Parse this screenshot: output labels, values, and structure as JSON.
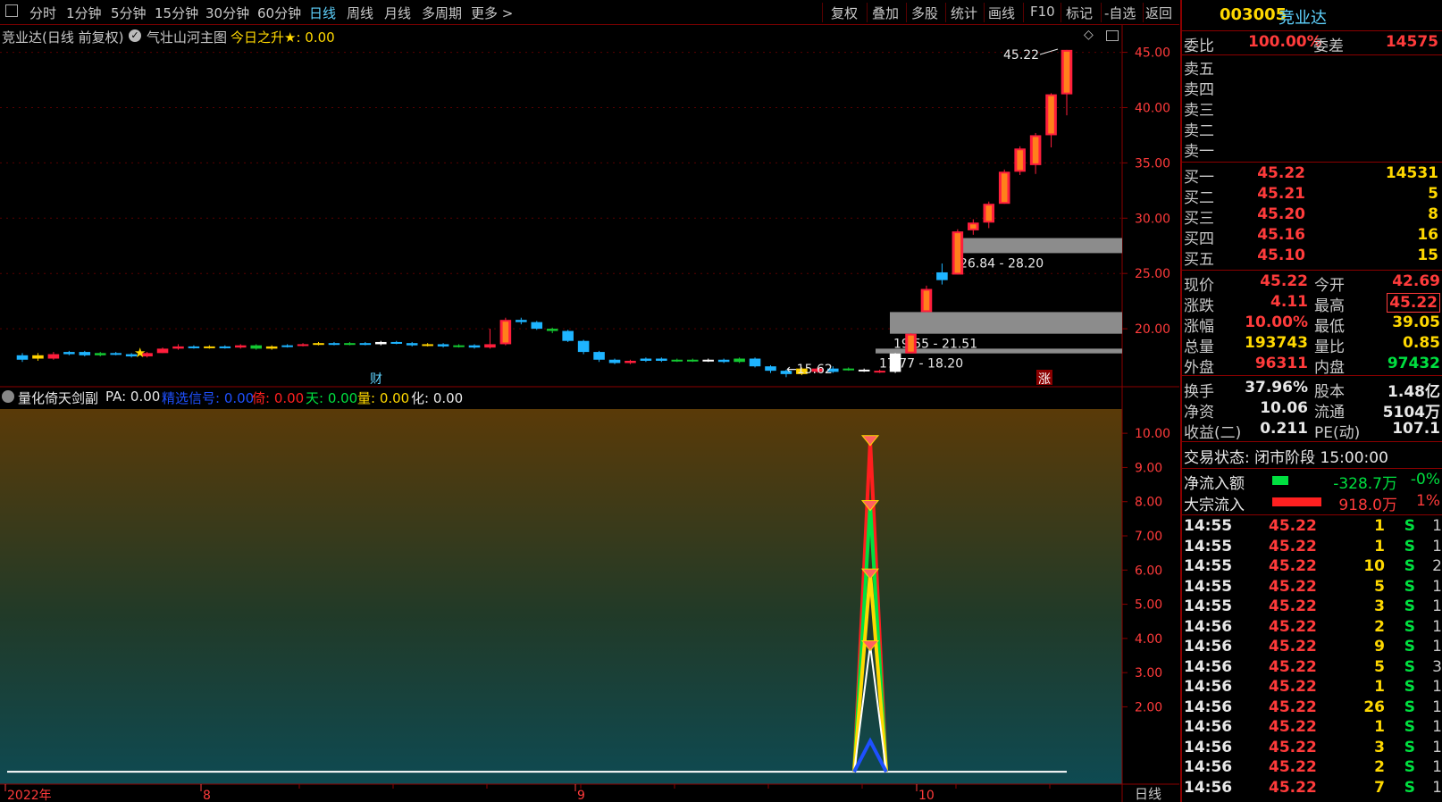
{
  "toolbar": {
    "left_items": [
      "分时",
      "1分钟",
      "5分钟",
      "15分钟",
      "30分钟",
      "60分钟",
      "日线",
      "周线",
      "月线",
      "多周期",
      "更多 >"
    ],
    "active": "日线",
    "right_items": [
      "复权",
      "叠加",
      "多股",
      "统计",
      "画线",
      "F10",
      "标记",
      "-自选",
      "返回"
    ]
  },
  "chart": {
    "title": "竞业达(日线 前复权)",
    "indicator": "气壮山河主图",
    "today_label": "今日之升★: 0.00",
    "price_axis": [
      "45.00",
      "40.00",
      "35.00",
      "30.00",
      "25.00",
      "20.00"
    ],
    "price_range": [
      15,
      46.5
    ],
    "high_label": "45.22",
    "low_label": "←15.62",
    "zones": [
      {
        "label": "26.84 - 28.20",
        "lo": 26.84,
        "hi": 28.2
      },
      {
        "label": "19.55 - 21.51",
        "lo": 19.55,
        "hi": 21.51
      },
      {
        "label": "17.77 - 18.20",
        "lo": 17.77,
        "hi": 18.2
      }
    ],
    "marker_cai": "财",
    "marker_zhang": "涨",
    "candles": [
      [
        17.2,
        17.6,
        17.0,
        17.8,
        "c"
      ],
      [
        17.6,
        17.3,
        17.1,
        17.8,
        "y"
      ],
      [
        17.3,
        17.7,
        17.2,
        17.9,
        "r"
      ],
      [
        17.7,
        17.9,
        17.6,
        18.0,
        "c"
      ],
      [
        17.9,
        17.6,
        17.5,
        18.0,
        "c"
      ],
      [
        17.6,
        17.8,
        17.5,
        17.9,
        "g"
      ],
      [
        17.8,
        17.7,
        17.6,
        17.9,
        "c"
      ],
      [
        17.7,
        17.5,
        17.4,
        17.8,
        "c"
      ],
      [
        17.5,
        17.8,
        17.4,
        17.9,
        "r"
      ],
      [
        17.8,
        18.2,
        17.8,
        18.3,
        "r"
      ],
      [
        18.2,
        18.4,
        18.1,
        18.6,
        "r"
      ],
      [
        18.4,
        18.3,
        18.2,
        18.5,
        "c"
      ],
      [
        18.3,
        18.4,
        18.2,
        18.5,
        "y"
      ],
      [
        18.4,
        18.3,
        18.2,
        18.5,
        "c"
      ],
      [
        18.3,
        18.5,
        18.2,
        18.6,
        "r"
      ],
      [
        18.5,
        18.2,
        18.1,
        18.6,
        "g"
      ],
      [
        18.2,
        18.4,
        18.1,
        18.5,
        "y"
      ],
      [
        18.4,
        18.5,
        18.3,
        18.6,
        "c"
      ],
      [
        18.5,
        18.6,
        18.4,
        18.7,
        "r"
      ],
      [
        18.6,
        18.7,
        18.5,
        18.8,
        "y"
      ],
      [
        18.7,
        18.6,
        18.5,
        18.8,
        "c"
      ],
      [
        18.6,
        18.7,
        18.5,
        18.8,
        "g"
      ],
      [
        18.7,
        18.6,
        18.5,
        18.8,
        "c"
      ],
      [
        18.6,
        18.8,
        18.5,
        18.9,
        "w"
      ],
      [
        18.8,
        18.7,
        18.6,
        18.9,
        "c"
      ],
      [
        18.7,
        18.5,
        18.4,
        18.8,
        "c"
      ],
      [
        18.5,
        18.6,
        18.4,
        18.7,
        "y"
      ],
      [
        18.6,
        18.4,
        18.3,
        18.7,
        "c"
      ],
      [
        18.4,
        18.5,
        18.3,
        18.6,
        "g"
      ],
      [
        18.5,
        18.3,
        18.2,
        18.6,
        "c"
      ],
      [
        18.3,
        18.6,
        18.2,
        20.0,
        "r"
      ],
      [
        18.6,
        20.8,
        18.5,
        21.0,
        "r"
      ],
      [
        20.8,
        20.6,
        20.4,
        21.0,
        "c"
      ],
      [
        20.6,
        20.0,
        19.9,
        20.7,
        "c"
      ],
      [
        20.0,
        19.8,
        19.6,
        20.1,
        "g"
      ],
      [
        19.8,
        18.9,
        18.8,
        19.9,
        "c"
      ],
      [
        18.9,
        17.9,
        17.7,
        19.0,
        "c"
      ],
      [
        17.9,
        17.2,
        17.0,
        18.0,
        "c"
      ],
      [
        17.2,
        16.9,
        16.8,
        17.3,
        "c"
      ],
      [
        16.9,
        17.1,
        16.8,
        17.2,
        "r"
      ],
      [
        17.1,
        17.3,
        17.0,
        17.4,
        "c"
      ],
      [
        17.3,
        17.1,
        17.0,
        17.4,
        "c"
      ],
      [
        17.1,
        17.2,
        17.0,
        17.3,
        "g"
      ],
      [
        17.2,
        17.1,
        17.0,
        17.3,
        "g"
      ],
      [
        17.1,
        17.2,
        17.0,
        17.3,
        "w"
      ],
      [
        17.2,
        17.0,
        16.9,
        17.3,
        "c"
      ],
      [
        17.0,
        17.3,
        16.9,
        17.4,
        "g"
      ],
      [
        17.3,
        16.6,
        16.5,
        17.4,
        "c"
      ],
      [
        16.6,
        16.2,
        16.0,
        16.7,
        "c"
      ],
      [
        16.2,
        15.9,
        15.62,
        16.3,
        "c"
      ],
      [
        15.9,
        16.4,
        15.8,
        16.5,
        "y"
      ],
      [
        16.4,
        16.1,
        16.0,
        16.5,
        "r"
      ],
      [
        16.1,
        16.4,
        16.0,
        16.6,
        "c"
      ],
      [
        16.4,
        16.3,
        16.2,
        16.5,
        "g"
      ],
      [
        16.3,
        16.2,
        16.1,
        16.4,
        "w"
      ],
      [
        16.2,
        16.1,
        16.0,
        16.3,
        "r"
      ],
      [
        16.1,
        17.77,
        16.0,
        17.8,
        "w"
      ],
      [
        17.77,
        19.55,
        17.77,
        19.6,
        "r"
      ],
      [
        21.51,
        23.6,
        21.51,
        23.9,
        "r"
      ],
      [
        24.4,
        25.1,
        24.0,
        25.9,
        "c"
      ],
      [
        24.9,
        28.8,
        24.9,
        29.0,
        "r"
      ],
      [
        28.9,
        29.6,
        28.5,
        29.9,
        "r"
      ],
      [
        29.6,
        31.3,
        29.1,
        31.5,
        "r"
      ],
      [
        31.3,
        34.2,
        31.3,
        34.4,
        "r"
      ],
      [
        34.2,
        36.3,
        33.9,
        36.5,
        "r"
      ],
      [
        34.8,
        37.5,
        34.0,
        37.7,
        "r"
      ],
      [
        37.5,
        41.2,
        36.4,
        41.3,
        "r"
      ],
      [
        41.2,
        45.22,
        39.3,
        45.22,
        "r"
      ]
    ],
    "sub_title": "量化倚天剑副",
    "sub_items": [
      {
        "t": "PA: 0.00",
        "c": "#e8e8e8"
      },
      {
        "t": "精选信号: 0.00",
        "c": "#1e50ff"
      },
      {
        "t": "倚: 0.00",
        "c": "#ff2020"
      },
      {
        "t": "天: 0.00",
        "c": "#00e040"
      },
      {
        "t": "量: 0.00",
        "c": "#ffd800"
      },
      {
        "t": "化: 0.00",
        "c": "#e8e8e8"
      }
    ],
    "sub_axis": [
      "10.00",
      "9.00",
      "8.00",
      "7.00",
      "6.00",
      "5.00",
      "4.00",
      "3.00",
      "2.00"
    ],
    "sub_range": [
      0,
      10.5
    ],
    "sub_peak": {
      "white": 3.8,
      "yellow": 5.9,
      "green": 7.9,
      "red": 9.8,
      "blue": 1.0
    },
    "time_axis": [
      "2022年",
      "8",
      "9",
      "10"
    ],
    "period_label": "日线"
  },
  "quote": {
    "code": "003005",
    "name": "竞业达",
    "weibi_label": "委比",
    "weibi": "100.00%",
    "weicha_label": "委差",
    "weicha": "14575",
    "asks": [
      {
        "label": "卖五"
      },
      {
        "label": "卖四"
      },
      {
        "label": "卖三"
      },
      {
        "label": "卖二"
      },
      {
        "label": "卖一"
      }
    ],
    "bids": [
      {
        "label": "买一",
        "price": "45.22",
        "vol": "14531"
      },
      {
        "label": "买二",
        "price": "45.21",
        "vol": "5"
      },
      {
        "label": "买三",
        "price": "45.20",
        "vol": "8"
      },
      {
        "label": "买四",
        "price": "45.16",
        "vol": "16"
      },
      {
        "label": "买五",
        "price": "45.10",
        "vol": "15"
      }
    ],
    "stats": [
      {
        "l1": "现价",
        "v1": "45.22",
        "c1": "red",
        "l2": "今开",
        "v2": "42.69",
        "c2": "red"
      },
      {
        "l1": "涨跌",
        "v1": "4.11",
        "c1": "red",
        "l2": "最高",
        "v2": "45.22",
        "c2": "red",
        "boxed": true
      },
      {
        "l1": "涨幅",
        "v1": "10.00%",
        "c1": "red",
        "l2": "最低",
        "v2": "39.05",
        "c2": "yel"
      },
      {
        "l1": "总量",
        "v1": "193743",
        "c1": "yel",
        "l2": "量比",
        "v2": "0.85",
        "c2": "yel"
      },
      {
        "l1": "外盘",
        "v1": "96311",
        "c1": "red",
        "l2": "内盘",
        "v2": "97432",
        "c2": "grn"
      }
    ],
    "stats2": [
      {
        "l1": "换手",
        "v1": "37.96%",
        "l2": "股本",
        "v2": "1.48亿"
      },
      {
        "l1": "净资",
        "v1": "10.06",
        "l2": "流通",
        "v2": "5104万"
      },
      {
        "l1": "收益(二)",
        "v1": "0.211",
        "l2": "PE(动)",
        "v2": "107.1"
      }
    ],
    "trade_status": "交易状态: 闭市阶段 15:00:00",
    "flows": [
      {
        "label": "净流入额",
        "value": "-328.7万",
        "pct": "-0%",
        "color": "#00e040",
        "bar": 0.18
      },
      {
        "label": "大宗流入",
        "value": "918.0万",
        "pct": "1%",
        "color": "#ff2020",
        "bar": 0.55
      }
    ],
    "ticks": [
      {
        "t": "14:55",
        "p": "45.22",
        "v": "1",
        "s": "S",
        "n": "1"
      },
      {
        "t": "14:55",
        "p": "45.22",
        "v": "1",
        "s": "S",
        "n": "1"
      },
      {
        "t": "14:55",
        "p": "45.22",
        "v": "10",
        "s": "S",
        "n": "2"
      },
      {
        "t": "14:55",
        "p": "45.22",
        "v": "5",
        "s": "S",
        "n": "1"
      },
      {
        "t": "14:55",
        "p": "45.22",
        "v": "3",
        "s": "S",
        "n": "1"
      },
      {
        "t": "14:56",
        "p": "45.22",
        "v": "2",
        "s": "S",
        "n": "1"
      },
      {
        "t": "14:56",
        "p": "45.22",
        "v": "9",
        "s": "S",
        "n": "1"
      },
      {
        "t": "14:56",
        "p": "45.22",
        "v": "5",
        "s": "S",
        "n": "3"
      },
      {
        "t": "14:56",
        "p": "45.22",
        "v": "1",
        "s": "S",
        "n": "1"
      },
      {
        "t": "14:56",
        "p": "45.22",
        "v": "26",
        "s": "S",
        "n": "1"
      },
      {
        "t": "14:56",
        "p": "45.22",
        "v": "1",
        "s": "S",
        "n": "1"
      },
      {
        "t": "14:56",
        "p": "45.22",
        "v": "3",
        "s": "S",
        "n": "1"
      },
      {
        "t": "14:56",
        "p": "45.22",
        "v": "2",
        "s": "S",
        "n": "1"
      },
      {
        "t": "14:56",
        "p": "45.22",
        "v": "7",
        "s": "S",
        "n": "1"
      }
    ]
  }
}
